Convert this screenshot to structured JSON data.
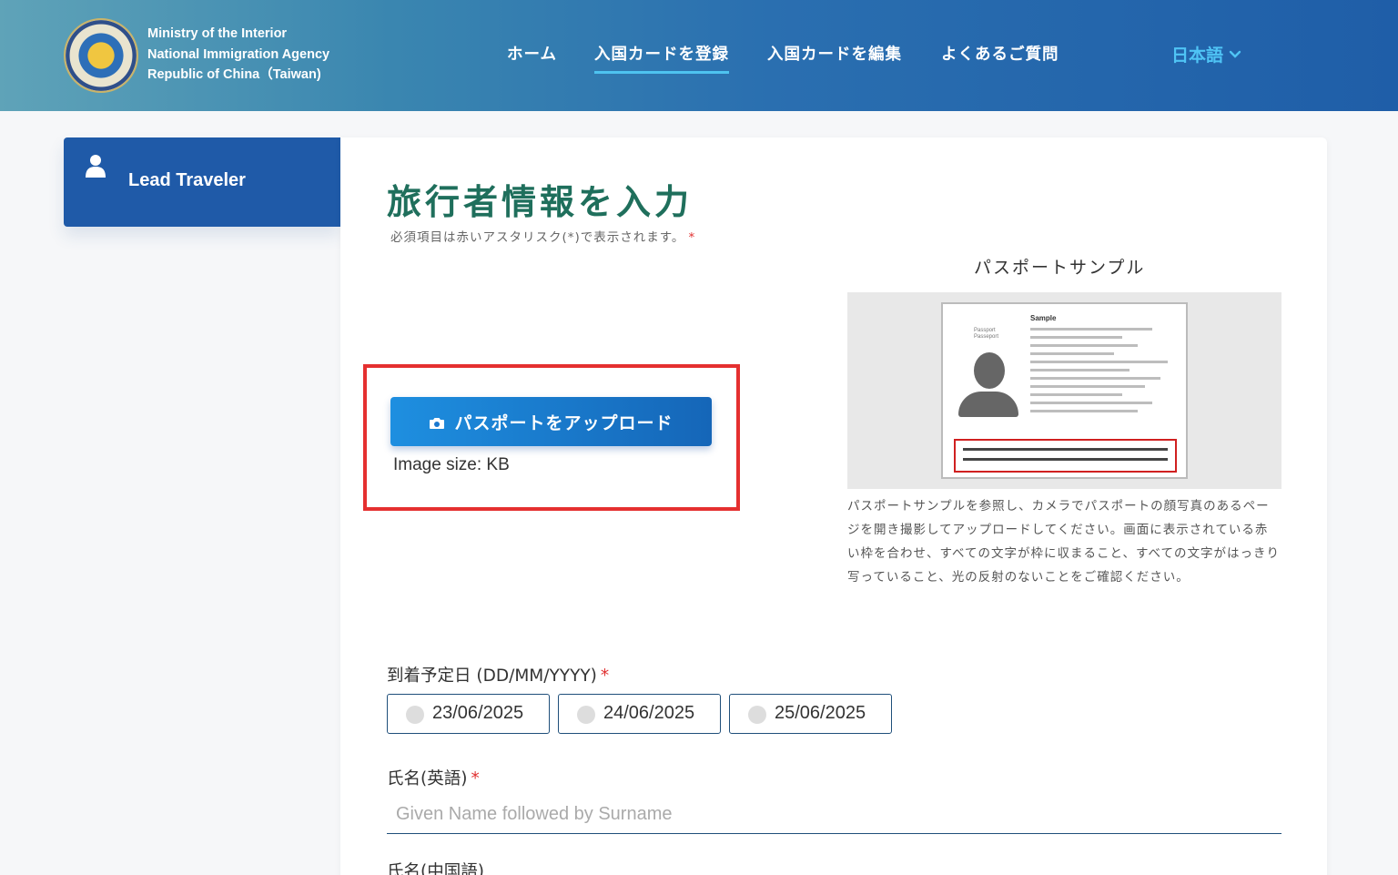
{
  "header": {
    "logo_lines": [
      "Ministry of the Interior",
      "National Immigration Agency",
      "Republic of China（Taiwan)"
    ],
    "nav": [
      {
        "label": "ホーム",
        "active": false
      },
      {
        "label": "入国カードを登録",
        "active": true
      },
      {
        "label": "入国カードを編集",
        "active": false
      },
      {
        "label": "よくあるご質問",
        "active": false
      }
    ],
    "language": "日本語",
    "language_icon": "chevron-down-icon",
    "accent_color": "#4ec3f0"
  },
  "sidebar": {
    "item_label": "Lead Traveler",
    "item_icon": "user-icon"
  },
  "main": {
    "title": "旅行者情報を入力",
    "required_note": "必須項目は赤いアスタリスク(*)で表示されます。",
    "required_mark": "*",
    "upload": {
      "button_label": "パスポートをアップロード",
      "button_icon": "camera-icon",
      "image_size": "Image size: KB",
      "highlight_color": "#e53030"
    },
    "sample": {
      "title": "パスポートサンプル",
      "passport_label": "Sample",
      "passport_type": "Passport\nPasseport",
      "description": "パスポートサンプルを参照し、カメラでパスポートの顔写真のあるページを開き撮影してアップロードしてください。画面に表示されている赤い枠を合わせ、すべての文字が枠に収まること、すべての文字がはっきり写っていること、光の反射のないことをご確認ください。"
    },
    "arrival": {
      "label": "到着予定日 (DD/MM/YYYY)",
      "required_mark": "*",
      "options": [
        "23/06/2025",
        "24/06/2025",
        "25/06/2025"
      ]
    },
    "name_en": {
      "label": "氏名(英語)",
      "required_mark": "*",
      "placeholder": "Given Name followed by Surname"
    },
    "name_zh": {
      "label": "氏名(中国語)"
    }
  }
}
